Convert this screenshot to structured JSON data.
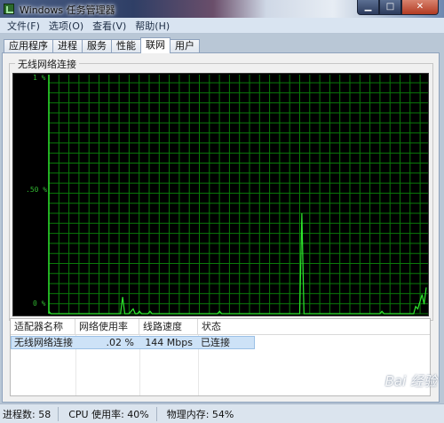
{
  "window": {
    "title": "Windows 任务管理器",
    "minimize_glyph": "▁",
    "maximize_glyph": "□",
    "close_glyph": "✕"
  },
  "menu": [
    "文件(F)",
    "选项(O)",
    "查看(V)",
    "帮助(H)"
  ],
  "tabs": [
    {
      "label": "应用程序",
      "active": false
    },
    {
      "label": "进程",
      "active": false
    },
    {
      "label": "服务",
      "active": false
    },
    {
      "label": "性能",
      "active": false
    },
    {
      "label": "联网",
      "active": true
    },
    {
      "label": "用户",
      "active": false
    }
  ],
  "graph": {
    "group_title": "无线网络连接",
    "y_labels": {
      "top": "1 %",
      "mid": ".50 %",
      "bottom": "0 %"
    },
    "colors": {
      "grid": "#0a7a0a",
      "line": "#2ee82e",
      "axis_label": "#31b531"
    },
    "chart_data": {
      "type": "line",
      "ylim": [
        0,
        1
      ],
      "y_unit": "%",
      "values": [
        0.01,
        0.0,
        0.0,
        0.0,
        0.0,
        0.0,
        0.0,
        0.0,
        0.0,
        0.0,
        0.0,
        0.0,
        0.0,
        0.0,
        0.0,
        0.0,
        0.0,
        0.0,
        0.0,
        0.0,
        0.0,
        0.0,
        0.0,
        0.0,
        0.0,
        0.0,
        0.0,
        0.0,
        0.0,
        0.0,
        0.0,
        0.0,
        0.0,
        0.0,
        0.0,
        0.07,
        0.0,
        0.0,
        0.0,
        0.01,
        0.02,
        0.0,
        0.0,
        0.01,
        0.0,
        0.0,
        0.0,
        0.0,
        0.01,
        0.0,
        0.0,
        0.0,
        0.0,
        0.0,
        0.0,
        0.0,
        0.0,
        0.0,
        0.0,
        0.0,
        0.0,
        0.0,
        0.0,
        0.0,
        0.0,
        0.0,
        0.0,
        0.0,
        0.0,
        0.0,
        0.0,
        0.0,
        0.0,
        0.0,
        0.0,
        0.0,
        0.0,
        0.0,
        0.0,
        0.0,
        0.0,
        0.01,
        0.0,
        0.0,
        0.0,
        0.0,
        0.0,
        0.0,
        0.0,
        0.0,
        0.0,
        0.0,
        0.0,
        0.0,
        0.0,
        0.0,
        0.0,
        0.0,
        0.0,
        0.0,
        0.0,
        0.0,
        0.0,
        0.0,
        0.0,
        0.0,
        0.0,
        0.0,
        0.0,
        0.0,
        0.0,
        0.0,
        0.0,
        0.0,
        0.0,
        0.0,
        0.0,
        0.0,
        0.0,
        0.0,
        0.42,
        0.0,
        0.0,
        0.0,
        0.0,
        0.0,
        0.0,
        0.0,
        0.0,
        0.0,
        0.0,
        0.0,
        0.0,
        0.0,
        0.0,
        0.0,
        0.0,
        0.0,
        0.0,
        0.0,
        0.0,
        0.0,
        0.0,
        0.0,
        0.0,
        0.0,
        0.0,
        0.0,
        0.0,
        0.0,
        0.0,
        0.0,
        0.0,
        0.0,
        0.0,
        0.0,
        0.0,
        0.0,
        0.01,
        0.0,
        0.0,
        0.0,
        0.0,
        0.0,
        0.0,
        0.0,
        0.0,
        0.0,
        0.0,
        0.0,
        0.0,
        0.0,
        0.0,
        0.0,
        0.03,
        0.02,
        0.05,
        0.08,
        0.04,
        0.11
      ]
    }
  },
  "table": {
    "headers": [
      "适配器名称",
      "网络使用率",
      "线路速度",
      "状态"
    ],
    "rows": [
      {
        "name": "无线网络连接",
        "usage": ".02 %",
        "speed": "144 Mbps",
        "state": "已连接"
      }
    ]
  },
  "status": {
    "processes": "进程数: 58",
    "cpu": "CPU 使用率: 40%",
    "memory": "物理内存: 54%"
  },
  "watermark": "Bai 经验"
}
